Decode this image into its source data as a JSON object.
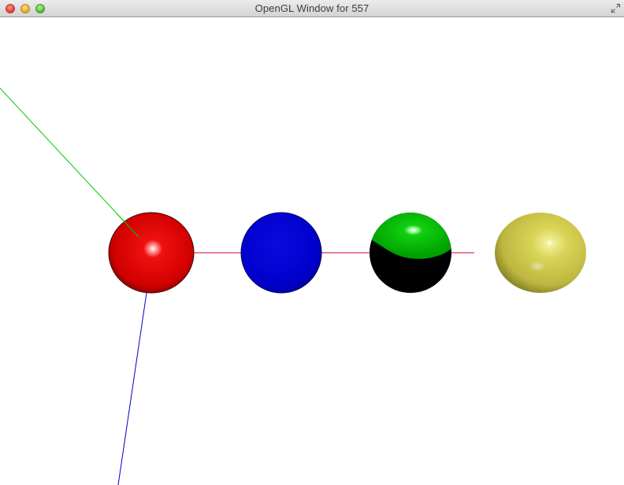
{
  "window": {
    "title": "OpenGL Window for 557"
  },
  "icons": {
    "close": "close-icon",
    "minimize": "minimize-icon",
    "maximize": "zoom-icon",
    "fullscreen": "fullscreen-icon"
  },
  "scene": {
    "background_color": "#ffffff",
    "spheres": [
      {
        "name": "red-sphere",
        "color": "#e00000",
        "shading": "specular highlight"
      },
      {
        "name": "blue-sphere",
        "color": "#0000d0",
        "shading": "flat/diffuse"
      },
      {
        "name": "green-black-sphere",
        "color": "#00cc00",
        "secondary_color": "#000000",
        "shading": "half lit"
      },
      {
        "name": "yellow-sphere",
        "color": "#c8c040",
        "shading": "specular highlight"
      }
    ],
    "axes": [
      {
        "name": "x-axis",
        "color": "#cc0033"
      },
      {
        "name": "y-axis",
        "color": "#00cc00"
      },
      {
        "name": "z-axis",
        "color": "#0000cc"
      }
    ]
  }
}
